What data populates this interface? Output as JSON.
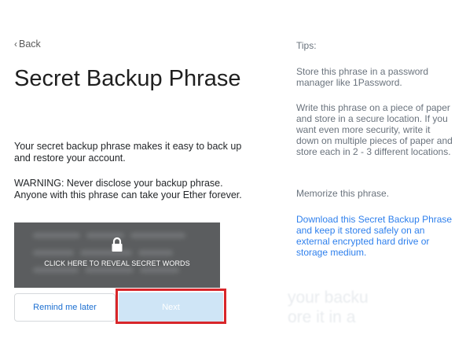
{
  "nav": {
    "back_chevron": "‹",
    "back_label": "Back"
  },
  "title": "Secret Backup Phrase",
  "description": "Your secret backup phrase makes it easy to back up and restore your account.",
  "warning": "WARNING: Never disclose your backup phrase. Anyone with this phrase can take your Ether forever.",
  "reveal": {
    "label": "CLICK HERE TO REVEAL SECRET WORDS",
    "icon": "lock-icon"
  },
  "buttons": {
    "remind_later": "Remind me later",
    "next": "Next"
  },
  "tips": {
    "heading": "Tips:",
    "items": [
      "Store this phrase in a password manager like 1Password.",
      "Write this phrase on a piece of paper and store in a secure location. If you want even more security, write it down on multiple pieces of paper and store each in 2 - 3 different locations.",
      "Memorize this phrase.",
      "Download this Secret Backup Phrase and keep it stored safely on an external encrypted hard drive or storage medium."
    ]
  },
  "background_ghost_text": "your backu\nore it in a",
  "colors": {
    "reveal_bg": "#5b5d5f",
    "next_bg": "#cfe5f6",
    "highlight_border": "#d8262a",
    "link": "#2f80ed",
    "remind_text": "#1c6fd1"
  }
}
